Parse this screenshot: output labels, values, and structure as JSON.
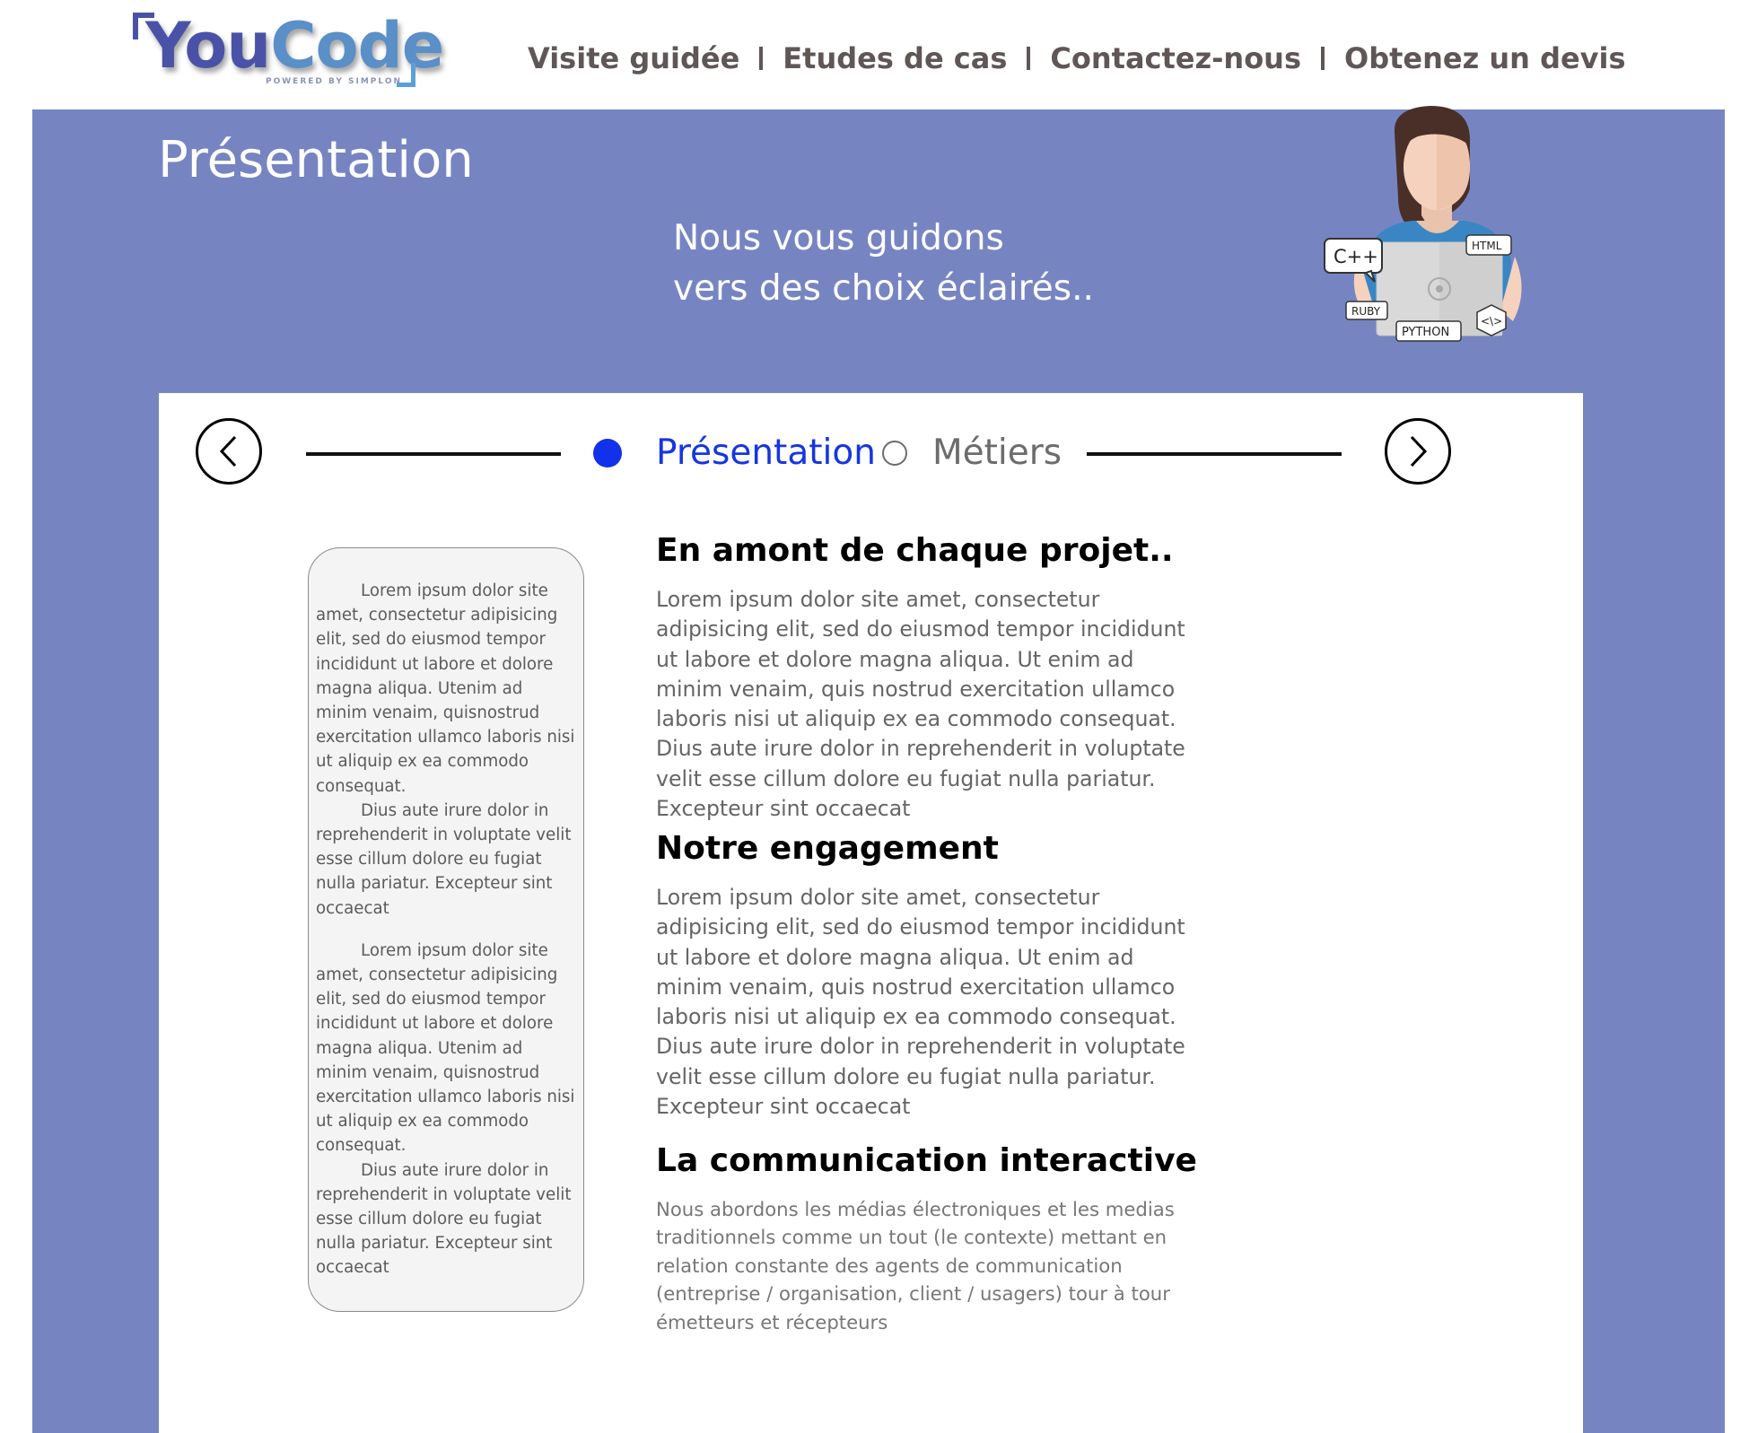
{
  "colors": {
    "banner": "#7685c2",
    "nav_text": "#5f5656",
    "active_step": "#1131ea",
    "inactive_step": "#6c6c6c",
    "logo_primary": "#4a52a8",
    "logo_secondary": "#5a8fc8"
  },
  "logo": {
    "text_part1": "You",
    "text_part2": "Code",
    "tagline": "POWERED BY SIMPLON"
  },
  "nav": {
    "items": [
      "Visite guidée",
      "Etudes de cas",
      "Contactez-nous",
      "Obtenez un devis"
    ],
    "separator": "I"
  },
  "banner": {
    "title": "Présentation",
    "tagline_line1": "Nous vous guidons",
    "tagline_line2": "vers des choix éclairés..",
    "illustration_labels": {
      "cpp": "C++",
      "html": "HTML",
      "ruby": "RUBY",
      "python": "PYTHON",
      "code": "<\\>"
    }
  },
  "stepper": {
    "prev_icon": "chevron-left-icon",
    "next_icon": "chevron-right-icon",
    "steps": [
      {
        "label": "Présentation",
        "active": true
      },
      {
        "label": "Métiers",
        "active": false
      }
    ]
  },
  "sidebar": {
    "paragraphs": [
      "Lorem ipsum dolor site amet, consectetur adipisicing elit, sed do eiusmod tempor incididunt ut labore et dolore magna aliqua. Utenim ad minim venaim, quisnostrud exercitation  ullamco laboris nisi ut aliquip ex ea commodo consequat.",
      "Dius aute irure dolor in reprehenderit in voluptate velit esse cillum dolore eu fugiat nulla pariatur. Excepteur sint occaecat",
      "Lorem ipsum dolor site amet, consectetur adipisicing elit, sed do eiusmod tempor incididunt ut labore et dolore magna aliqua. Utenim ad minim venaim, quisnostrud exercitation  ullamco laboris nisi ut aliquip ex ea commodo consequat.",
      "Dius aute irure dolor in reprehenderit in voluptate velit esse cillum dolore eu fugiat nulla pariatur. Excepteur sint occaecat"
    ]
  },
  "sections": [
    {
      "title": "En amont de chaque projet..",
      "body": "Lorem ipsum dolor site amet, consectetur adipisicing elit, sed do eiusmod tempor incididunt ut labore et dolore magna aliqua. Ut enim ad minim venaim, quis nostrud exercitation ullamco laboris nisi ut aliquip ex ea commodo consequat. Dius aute irure dolor in reprehenderit in voluptate velit esse cillum dolore eu fugiat nulla pariatur. Excepteur sint occaecat"
    },
    {
      "title": "Notre engagement",
      "body": "Lorem ipsum dolor site amet, consectetur adipisicing elit, sed do eiusmod tempor incididunt ut labore et dolore magna aliqua. Ut enim ad minim venaim, quis nostrud exercitation ullamco laboris nisi ut aliquip ex ea commodo consequat. Dius aute irure dolor in reprehenderit in voluptate velit esse cillum dolore eu fugiat nulla pariatur. Excepteur sint occaecat"
    },
    {
      "title": "La communication interactive",
      "body": "Nous abordons les médias électroniques et les medias traditionnels comme un tout (le contexte) mettant en relation constante des agents de  communication (entreprise / organisation, client / usagers) tour à tour émetteurs et récepteurs"
    }
  ]
}
